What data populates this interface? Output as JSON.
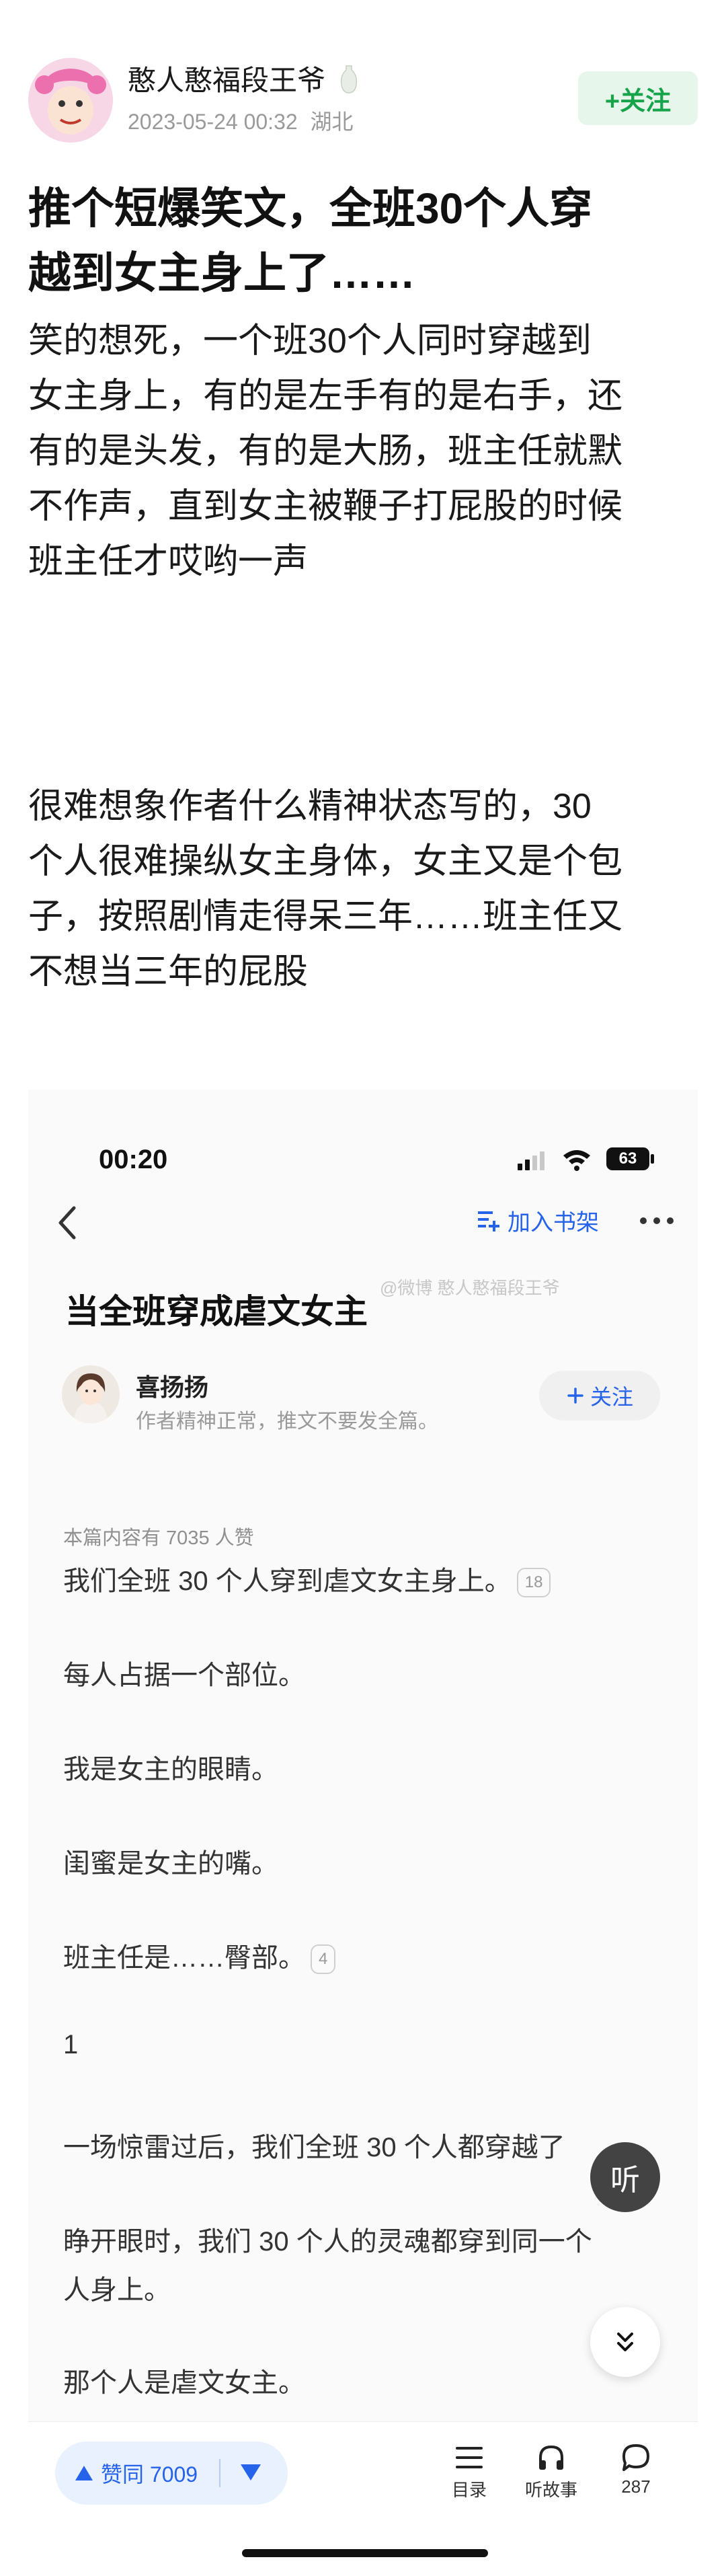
{
  "post": {
    "author_name": "憨人憨福段王爷",
    "date": "2023-05-24 00:32",
    "location": "湖北",
    "follow_label": "+关注",
    "title_lines": [
      "推个短爆笑文，全班30个人穿",
      "越到女主身上了……"
    ],
    "para1": [
      "笑的想死，一个班30个人同时穿越到",
      "女主身上，有的是左手有的是右手，还",
      "有的是头发，有的是大肠，班主任就默",
      "不作声，直到女主被鞭子打屁股的时候",
      "班主任才哎哟一声"
    ],
    "para2": [
      "很难想象作者什么精神状态写的，30",
      "个人很难操纵女主身体，女主又是个包",
      "子，按照剧情走得呆三年……班主任又",
      "不想当三年的屁股"
    ]
  },
  "screenshot": {
    "status_time": "00:20",
    "battery": "63",
    "shelf_label": "加入书架",
    "watermark": "@微博 憨人憨福段王爷",
    "story_title": "当全班穿成虐文女主",
    "writer_name": "喜扬扬",
    "writer_sub": "作者精神正常，推文不要发全篇。",
    "writer_follow": "关注",
    "likes_note": "本篇内容有 7035 人赞",
    "lines": [
      {
        "text": "我们全班 30 个人穿到虐文女主身上。",
        "badge": "18"
      },
      {
        "text": "每人占据一个部位。",
        "badge": ""
      },
      {
        "text": "我是女主的眼睛。",
        "badge": ""
      },
      {
        "text": "闺蜜是女主的嘴。",
        "badge": ""
      },
      {
        "text": "班主任是……臀部。",
        "badge": "4"
      },
      {
        "text": "1",
        "badge": ""
      },
      {
        "text": "一场惊雷过后，我们全班 30 个人都穿越了",
        "badge": ""
      },
      {
        "text": "睁开眼时，我们 30 个人的灵魂都穿到同一个",
        "badge": ""
      },
      {
        "text": "人身上。",
        "badge": ""
      },
      {
        "text": "那个人是虐文女主。",
        "badge": ""
      }
    ],
    "listen_label": "听",
    "vote_label": "赞同 7009",
    "toolbar": {
      "catalog": "目录",
      "listen_story": "听故事",
      "comments": "287"
    }
  }
}
